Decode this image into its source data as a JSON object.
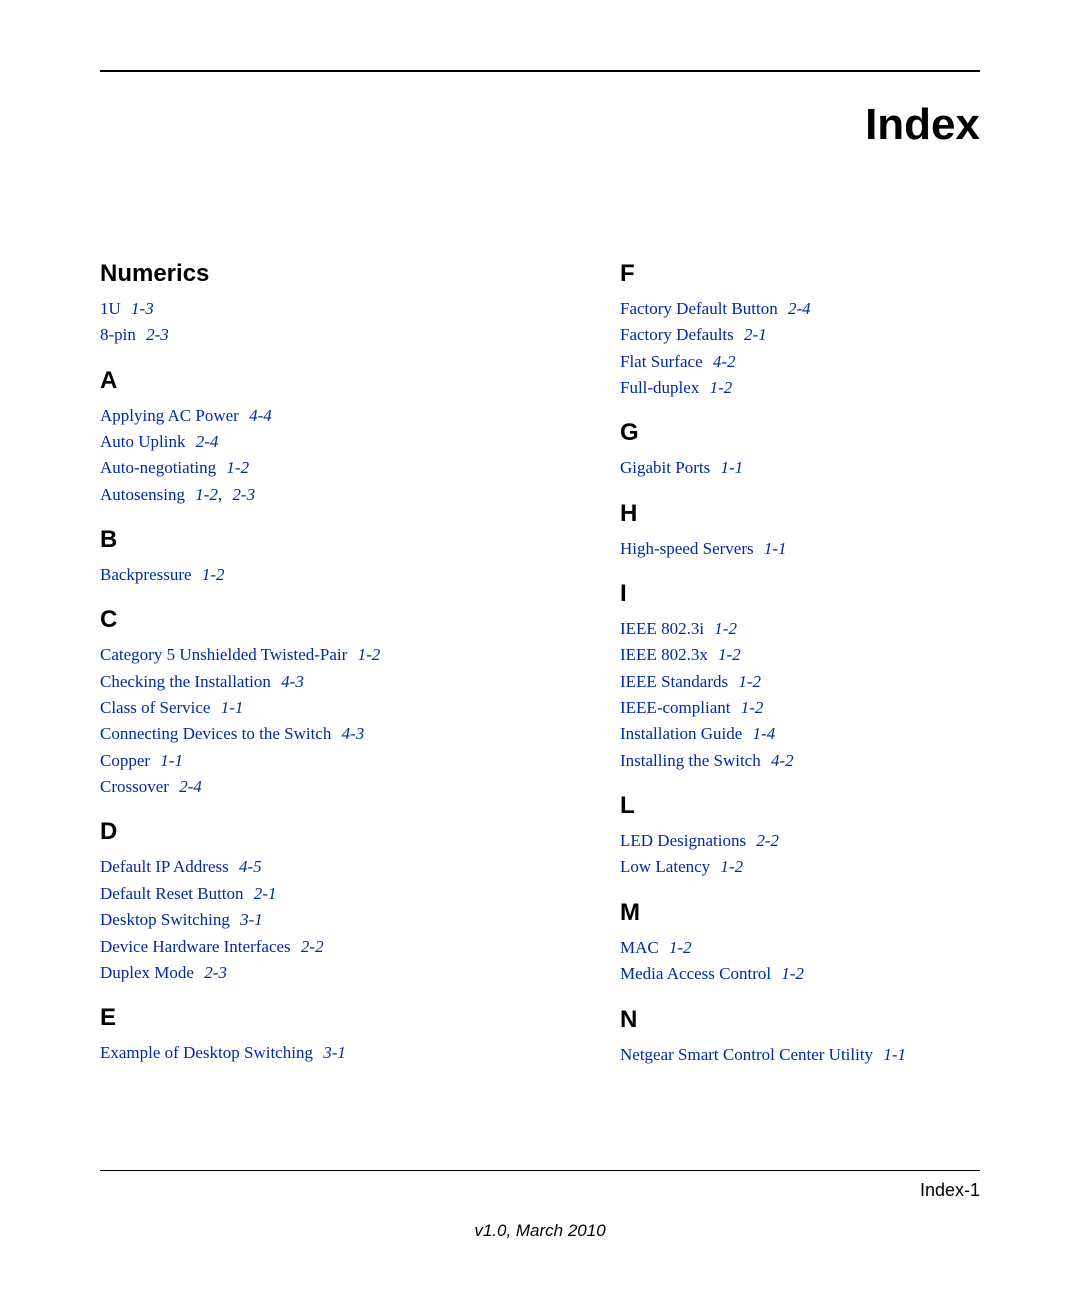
{
  "title": "Index",
  "page_number": "Index-1",
  "footer": "v1.0, March 2010",
  "left": [
    {
      "heading": "Numerics",
      "entries": [
        {
          "term": "1U",
          "refs": [
            "1-3"
          ]
        },
        {
          "term": "8-pin",
          "refs": [
            "2-3"
          ]
        }
      ]
    },
    {
      "heading": "A",
      "entries": [
        {
          "term": "Applying AC Power",
          "refs": [
            "4-4"
          ]
        },
        {
          "term": "Auto Uplink",
          "refs": [
            "2-4"
          ]
        },
        {
          "term": "Auto-negotiating",
          "refs": [
            "1-2"
          ]
        },
        {
          "term": "Autosensing",
          "refs": [
            "1-2",
            "2-3"
          ]
        }
      ]
    },
    {
      "heading": "B",
      "entries": [
        {
          "term": "Backpressure",
          "refs": [
            "1-2"
          ]
        }
      ]
    },
    {
      "heading": "C",
      "entries": [
        {
          "term": "Category 5 Unshielded Twisted-Pair",
          "refs": [
            "1-2"
          ]
        },
        {
          "term": "Checking the Installation",
          "refs": [
            "4-3"
          ]
        },
        {
          "term": "Class of Service",
          "refs": [
            "1-1"
          ]
        },
        {
          "term": "Connecting Devices to the Switch",
          "refs": [
            "4-3"
          ]
        },
        {
          "term": "Copper",
          "refs": [
            "1-1"
          ]
        },
        {
          "term": "Crossover",
          "refs": [
            "2-4"
          ]
        }
      ]
    },
    {
      "heading": "D",
      "entries": [
        {
          "term": "Default IP Address",
          "refs": [
            "4-5"
          ]
        },
        {
          "term": "Default Reset Button",
          "refs": [
            "2-1"
          ]
        },
        {
          "term": "Desktop Switching",
          "refs": [
            "3-1"
          ]
        },
        {
          "term": "Device Hardware Interfaces",
          "refs": [
            "2-2"
          ]
        },
        {
          "term": "Duplex Mode",
          "refs": [
            "2-3"
          ]
        }
      ]
    },
    {
      "heading": "E",
      "entries": [
        {
          "term": "Example of Desktop Switching",
          "refs": [
            "3-1"
          ]
        }
      ]
    }
  ],
  "right": [
    {
      "heading": "F",
      "entries": [
        {
          "term": "Factory Default Button",
          "refs": [
            "2-4"
          ]
        },
        {
          "term": "Factory Defaults",
          "refs": [
            "2-1"
          ]
        },
        {
          "term": "Flat Surface",
          "refs": [
            "4-2"
          ]
        },
        {
          "term": "Full-duplex",
          "refs": [
            "1-2"
          ]
        }
      ]
    },
    {
      "heading": "G",
      "entries": [
        {
          "term": "Gigabit Ports",
          "refs": [
            "1-1"
          ]
        }
      ]
    },
    {
      "heading": "H",
      "entries": [
        {
          "term": "High-speed Servers",
          "refs": [
            "1-1"
          ]
        }
      ]
    },
    {
      "heading": "I",
      "entries": [
        {
          "term": "IEEE 802.3i",
          "refs": [
            "1-2"
          ]
        },
        {
          "term": "IEEE 802.3x",
          "refs": [
            "1-2"
          ]
        },
        {
          "term": "IEEE Standards",
          "refs": [
            "1-2"
          ]
        },
        {
          "term": "IEEE-compliant",
          "refs": [
            "1-2"
          ]
        },
        {
          "term": "Installation Guide",
          "refs": [
            "1-4"
          ]
        },
        {
          "term": "Installing the Switch",
          "refs": [
            "4-2"
          ]
        }
      ]
    },
    {
      "heading": "L",
      "entries": [
        {
          "term": "LED Designations",
          "refs": [
            "2-2"
          ]
        },
        {
          "term": "Low Latency",
          "refs": [
            "1-2"
          ]
        }
      ]
    },
    {
      "heading": "M",
      "entries": [
        {
          "term": "MAC",
          "refs": [
            "1-2"
          ]
        },
        {
          "term": "Media Access Control",
          "refs": [
            "1-2"
          ]
        }
      ]
    },
    {
      "heading": "N",
      "entries": [
        {
          "term": "Netgear Smart Control Center Utility",
          "refs": [
            "1-1"
          ]
        }
      ]
    }
  ]
}
